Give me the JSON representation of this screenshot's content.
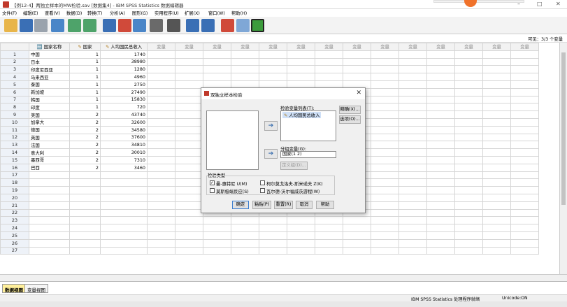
{
  "window": {
    "title": "【例12-4】两独立样本的MW检验.sav [数据集4] - IBM SPSS Statistics 数据编辑器"
  },
  "menu": [
    "文件(F)",
    "编辑(E)",
    "查看(V)",
    "数据(D)",
    "转换(T)",
    "分析(A)",
    "图形(G)",
    "实用程序(U)",
    "扩展(X)",
    "窗口(W)",
    "帮助(H)"
  ],
  "visible_vars": "可见：3/3 个变量",
  "grid": {
    "columns": [
      "国家名称",
      "国家",
      "人均国民总收入"
    ],
    "empty_col_label": "变量",
    "rows": [
      [
        "中国",
        "1",
        "1740"
      ],
      [
        "日本",
        "1",
        "38980"
      ],
      [
        "印度尼西亚",
        "1",
        "1280"
      ],
      [
        "马来西亚",
        "1",
        "4960"
      ],
      [
        "泰国",
        "1",
        "2750"
      ],
      [
        "新加坡",
        "1",
        "27490"
      ],
      [
        "韩国",
        "1",
        "15830"
      ],
      [
        "印度",
        "1",
        "720"
      ],
      [
        "美国",
        "2",
        "43740"
      ],
      [
        "加拿大",
        "2",
        "32600"
      ],
      [
        "德国",
        "2",
        "34580"
      ],
      [
        "英国",
        "2",
        "37600"
      ],
      [
        "法国",
        "2",
        "34810"
      ],
      [
        "意大利",
        "2",
        "30010"
      ],
      [
        "墨西哥",
        "2",
        "7310"
      ],
      [
        "巴西",
        "2",
        "3460"
      ]
    ],
    "row_count": 27
  },
  "tabs": {
    "data_view": "数据视图",
    "variable_view": "变量视图"
  },
  "status": {
    "processor": "IBM SPSS Statistics 处理程序就绪",
    "unicode": "Unicode:ON"
  },
  "dialog": {
    "title": "双独立样本检验",
    "test_var_label": "检验变量列表(T):",
    "test_var_item": "人均国民总收入",
    "group_var_label": "分组变量(G):",
    "group_var_value": "国家(1 2)",
    "define_groups": "定义组(D)...",
    "exact": "精确(X)...",
    "options": "选项(O)...",
    "test_type_label": "检验类型",
    "tests": [
      {
        "label": "曼-惠特尼 U(M)",
        "checked": true
      },
      {
        "label": "柯尔莫戈洛夫-斯米诺夫 Z(K)",
        "checked": false
      },
      {
        "label": "莫斯极端反应(S)",
        "checked": false
      },
      {
        "label": "瓦尔德-沃尔福威茨游程(W)",
        "checked": false
      }
    ],
    "buttons": {
      "ok": "确定",
      "paste": "粘贴(P)",
      "reset": "重置(R)",
      "cancel": "取消",
      "help": "帮助"
    }
  }
}
